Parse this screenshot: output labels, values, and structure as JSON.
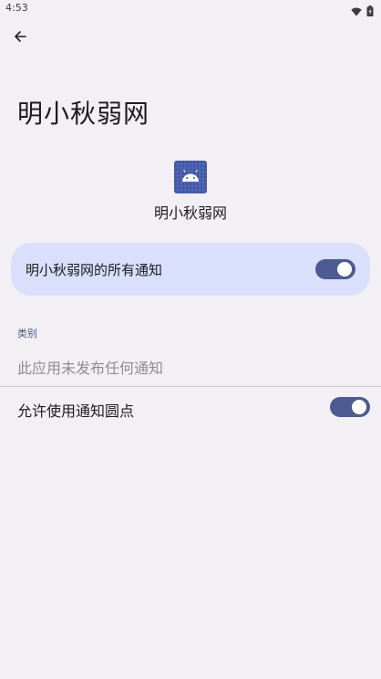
{
  "status_bar": {
    "time": "4:53",
    "icons": [
      "wifi-icon",
      "battery-icon"
    ]
  },
  "header": {
    "back_icon": "arrow-left-icon",
    "title": "明小秋弱网"
  },
  "app_info": {
    "icon": "android-app-icon",
    "name": "明小秋弱网"
  },
  "all_notifications": {
    "label": "明小秋弱网的所有通知",
    "enabled": true
  },
  "category_section": {
    "header": "类别",
    "empty_text": "此应用未发布任何通知"
  },
  "notification_dot": {
    "label": "允许使用通知圆点",
    "enabled": true
  },
  "colors": {
    "background": "#f2f0f5",
    "card": "#dae0fb",
    "toggle_on": "#4d5b93",
    "icon_blue": "#3f55a4"
  }
}
